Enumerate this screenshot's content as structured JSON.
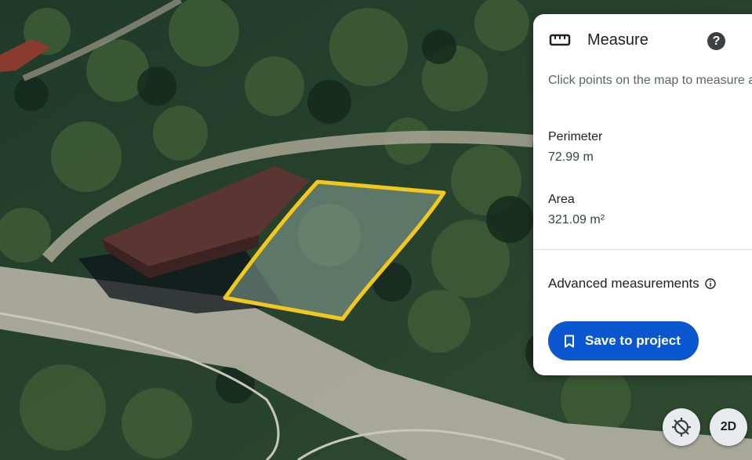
{
  "panel": {
    "title": "Measure",
    "title_icon": "ruler-icon",
    "help_icon": "help-icon",
    "help_glyph": "?",
    "instructions": "Click points on the map to measure area",
    "perimeter_label": "Perimeter",
    "perimeter_value": "72.99 m",
    "area_label": "Area",
    "area_value": "321.09 m²",
    "advanced_label": "Advanced measurements",
    "advanced_icon": "info-icon",
    "save_label": "Save to project",
    "save_icon": "bookmark-icon"
  },
  "controls": {
    "view_mode_label": "2D",
    "compass_icon": "compass-reset-icon"
  },
  "colors": {
    "polygon_outline": "#f2c81d",
    "save_button": "#0b57d0",
    "panel_bg": "#ffffff"
  }
}
